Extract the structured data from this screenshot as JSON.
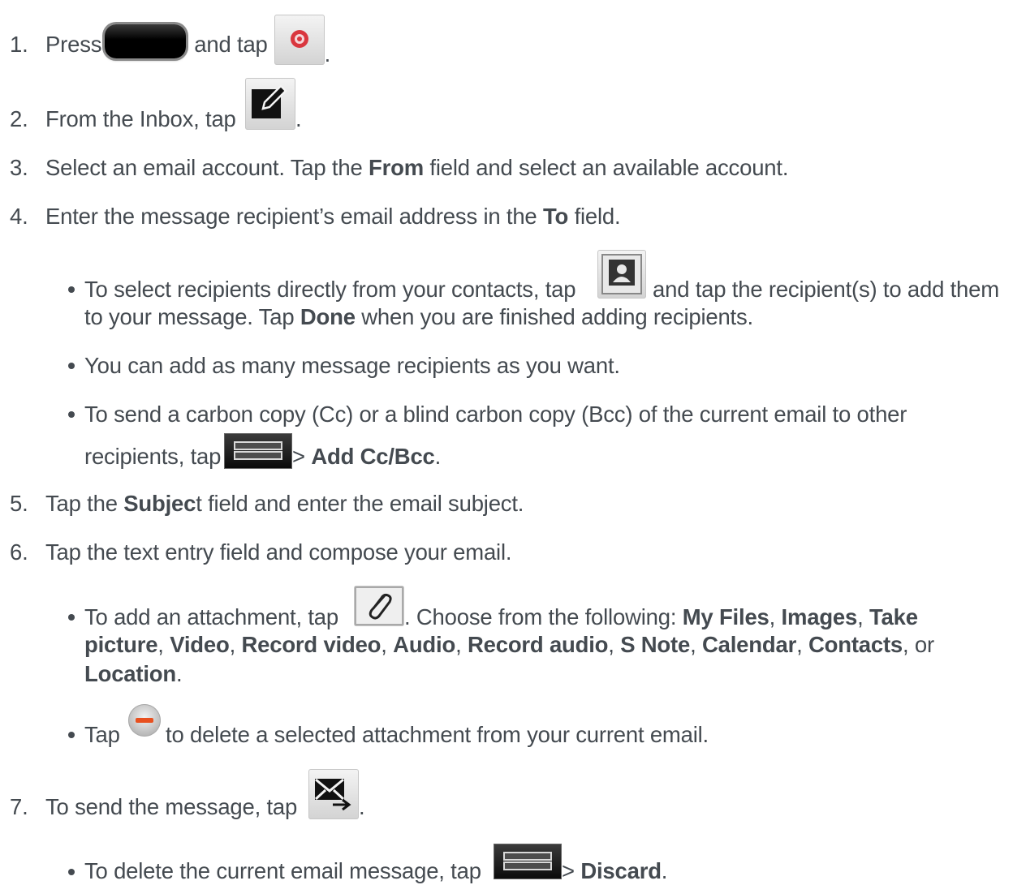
{
  "steps": {
    "s1": {
      "num": "1.",
      "a": "Press",
      "b": "and tap",
      "c": "."
    },
    "s2": {
      "num": "2.",
      "a": "From the Inbox, tap",
      "b": "."
    },
    "s3": {
      "num": "3.",
      "a": "Select an email account. Tap the ",
      "bold": "From",
      "b": " field and select an available account."
    },
    "s4": {
      "num": "4.",
      "a": "Enter the message recipient’s email address in the ",
      "bold": "To",
      "b": " field."
    },
    "s5": {
      "num": "5.",
      "a": "Tap the ",
      "bold": "Subjec",
      "b": "t field and enter the email subject."
    },
    "s6": {
      "num": "6.",
      "a": "Tap the text entry field and compose your email."
    },
    "s7": {
      "num": "7.",
      "a": "To send the message, tap",
      "b": "."
    }
  },
  "bullets": {
    "b1": {
      "a": "To select recipients directly from your contacts, tap",
      "b": "and tap the recipient(s) to add them",
      "c": "to your message. Tap ",
      "bold": "Done",
      "d": " when you are finished adding recipients."
    },
    "b2": {
      "a": "You can add as many message recipients as you want."
    },
    "b3": {
      "a": "To send a carbon copy (Cc) or a blind carbon copy (Bcc) of the current email to other",
      "b": "recipients, tap",
      "c": " > ",
      "bold": "Add Cc/Bcc",
      "d": "."
    },
    "b4": {
      "a": "To add an attachment, tap",
      "b": ". Choose from the following: ",
      "o1": "My Files",
      "o2": "Images",
      "o3a": "Take",
      "o3b": "picture",
      "o4": "Video",
      "o5": "Record video",
      "o6": "Audio",
      "o7": "Record audio",
      "o8": "S Note",
      "o9": "Calendar",
      "o10": "Contacts",
      "o11": "Location",
      "sep": ", ",
      "or": ", or",
      "end": "."
    },
    "b5": {
      "a": "Tap",
      "b": "to delete a selected attachment from your current email."
    },
    "b6": {
      "a": "To delete the current email message, tap",
      "c": " > ",
      "bold": "Discard",
      "d": "."
    }
  },
  "icons": {
    "home_key": "home-key-icon",
    "email_app": "email-app-icon",
    "compose": "compose-icon",
    "contacts": "contacts-icon",
    "menu": "menu-icon",
    "attach": "paperclip-icon",
    "remove": "minus-icon",
    "send": "send-icon",
    "accent_red": "#d9363e",
    "remove_orange": "#e8501f"
  }
}
